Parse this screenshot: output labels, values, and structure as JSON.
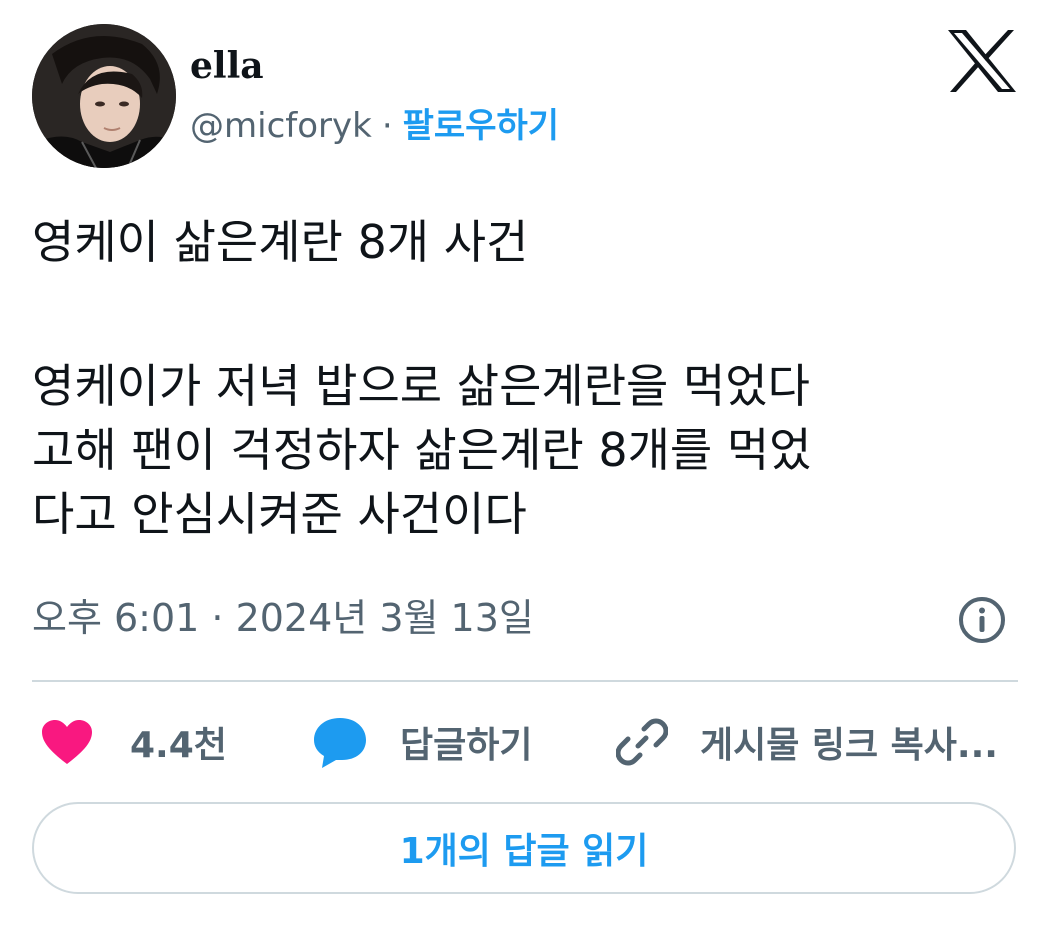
{
  "author": {
    "display_name": "ella",
    "handle": "@micforyk",
    "separator": "·",
    "follow_label": "팔로우하기"
  },
  "brand": {
    "logo_icon": "x-logo-icon"
  },
  "tweet": {
    "title_line": "영케이 삶은계란 8개 사건",
    "body_line1": "영케이가 저녁 밥으로 삶은계란을 먹었다",
    "body_line2": "고해 팬이 걱정하자 삶은계란 8개를 먹었",
    "body_line3": "다고 안심시켜준 사건이다"
  },
  "meta": {
    "timestamp": "오후 6:01 · 2024년 3월 13일",
    "info_icon": "info-icon"
  },
  "actions": {
    "like_count": "4.4천",
    "like_icon": "heart-icon",
    "reply_label": "답글하기",
    "reply_icon": "speech-bubble-icon",
    "copy_link_label": "게시물 링크 복사...",
    "copy_link_icon": "link-icon"
  },
  "read_replies_label": "1개의 답글 읽기",
  "colors": {
    "accent": "#1d9bf0",
    "like": "#f91880",
    "muted": "#536471",
    "text": "#0f1419",
    "border": "#cfd9de"
  }
}
